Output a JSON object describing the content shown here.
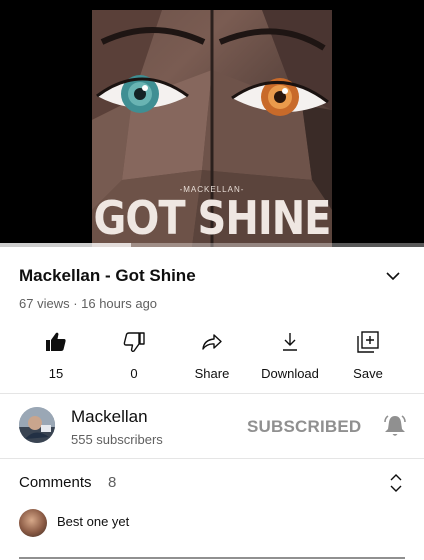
{
  "player": {
    "artwork_artist": "-MACKELLAN-",
    "artwork_title": "GOT SHINE",
    "progress_played": 0.0,
    "progress_buffered": 0.31
  },
  "video": {
    "title": "Mackellan - Got Shine",
    "meta": "67 views · 16 hours ago"
  },
  "actions": [
    {
      "name": "like",
      "label": "15"
    },
    {
      "name": "dislike",
      "label": "0"
    },
    {
      "name": "share",
      "label": "Share"
    },
    {
      "name": "download",
      "label": "Download"
    },
    {
      "name": "save",
      "label": "Save"
    }
  ],
  "channel": {
    "name": "Mackellan",
    "subscribers": "555 subscribers",
    "subscribe_state": "SUBSCRIBED"
  },
  "comments": {
    "label": "Comments",
    "count": "8",
    "top_comment": "Best one yet"
  },
  "colors": {
    "progress_red": "#ff0000",
    "secondary_text": "#606060",
    "subscribed_text": "#909090"
  },
  "icons": [
    "like-icon",
    "dislike-icon",
    "share-icon",
    "download-icon",
    "save-icon",
    "chevron-down-icon",
    "bell-icon",
    "expand-collapse-icon"
  ]
}
